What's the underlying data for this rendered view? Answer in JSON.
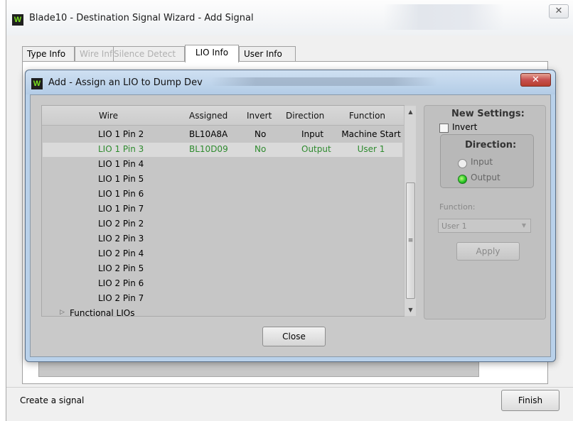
{
  "window": {
    "title": "Blade10 - Destination Signal Wizard - Add Signal",
    "icon": "app-w-icon",
    "close_glyph": "✕"
  },
  "tabs": [
    {
      "label": "Type Info",
      "state": "normal"
    },
    {
      "label": "Wire Info",
      "state": "disabled"
    },
    {
      "label": "Silence Detect",
      "state": "disabled"
    },
    {
      "label": "LIO Info",
      "state": "active"
    },
    {
      "label": "User Info",
      "state": "normal"
    }
  ],
  "dialog": {
    "title": "Add - Assign an LIO to Dump Dev",
    "close_glyph": "✕",
    "list": {
      "columns": [
        "Wire",
        "Assigned",
        "Invert",
        "Direction",
        "Function"
      ],
      "rows": [
        {
          "wire": "LIO 1 Pin 2",
          "assigned": "BL10A8A",
          "invert": "No",
          "direction": "Input",
          "function": "Machine Start",
          "selected": false
        },
        {
          "wire": "LIO 1 Pin 3",
          "assigned": "BL10D09",
          "invert": "No",
          "direction": "Output",
          "function": "User 1",
          "selected": true
        },
        {
          "wire": "LIO 1 Pin 4",
          "assigned": "",
          "invert": "",
          "direction": "",
          "function": "",
          "selected": false
        },
        {
          "wire": "LIO 1 Pin 5",
          "assigned": "",
          "invert": "",
          "direction": "",
          "function": "",
          "selected": false
        },
        {
          "wire": "LIO 1 Pin 6",
          "assigned": "",
          "invert": "",
          "direction": "",
          "function": "",
          "selected": false
        },
        {
          "wire": "LIO 1 Pin 7",
          "assigned": "",
          "invert": "",
          "direction": "",
          "function": "",
          "selected": false
        },
        {
          "wire": "LIO 2 Pin 2",
          "assigned": "",
          "invert": "",
          "direction": "",
          "function": "",
          "selected": false
        },
        {
          "wire": "LIO 2 Pin 3",
          "assigned": "",
          "invert": "",
          "direction": "",
          "function": "",
          "selected": false
        },
        {
          "wire": "LIO 2 Pin 4",
          "assigned": "",
          "invert": "",
          "direction": "",
          "function": "",
          "selected": false
        },
        {
          "wire": "LIO 2 Pin 5",
          "assigned": "",
          "invert": "",
          "direction": "",
          "function": "",
          "selected": false
        },
        {
          "wire": "LIO 2 Pin 6",
          "assigned": "",
          "invert": "",
          "direction": "",
          "function": "",
          "selected": false
        },
        {
          "wire": "LIO 2 Pin 7",
          "assigned": "",
          "invert": "",
          "direction": "",
          "function": "",
          "selected": false
        }
      ],
      "group": {
        "label": "Functional LIOs",
        "expanded": false
      }
    },
    "settings": {
      "title": "New Settings:",
      "invert_label": "Invert",
      "invert_checked": false,
      "direction_title": "Direction:",
      "direction_options": [
        {
          "label": "Input",
          "selected": false
        },
        {
          "label": "Output",
          "selected": true
        }
      ],
      "function_label": "Function:",
      "function_value": "User 1",
      "apply_label": "Apply"
    },
    "close_label": "Close"
  },
  "status": {
    "text": "Create a signal",
    "finish_label": "Finish"
  },
  "colors": {
    "selected_row_text": "#2e8b2e",
    "dialog_frame": "#b9d1ea",
    "close_button_red": "#c75050"
  }
}
